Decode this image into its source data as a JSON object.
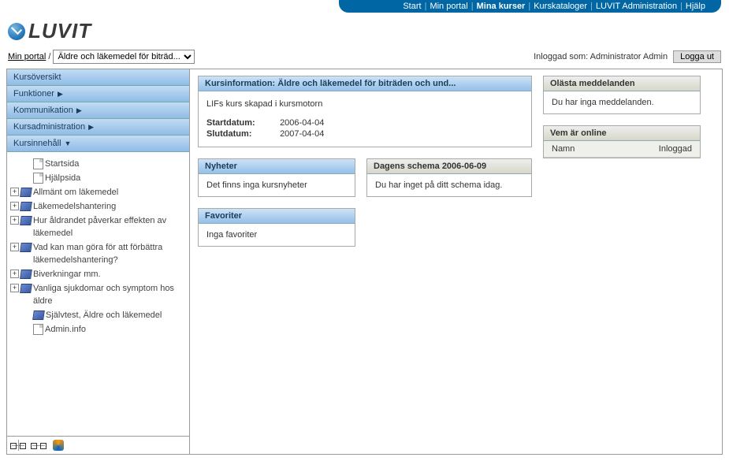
{
  "topnav": {
    "items": [
      {
        "label": "Start"
      },
      {
        "label": "Min portal"
      },
      {
        "label": "Mina kurser",
        "active": true
      },
      {
        "label": "Kurskataloger"
      },
      {
        "label": "LUVIT Administration"
      },
      {
        "label": "Hjälp"
      }
    ]
  },
  "logo": {
    "text": "LUVIT"
  },
  "breadcrumb": {
    "portal_link": "Min portal",
    "sep": " / ",
    "course_select_value": "Äldre och läkemedel för biträd..."
  },
  "login": {
    "prefix": "Inloggad som: ",
    "user": "Administrator Admin",
    "logout": "Logga ut"
  },
  "sidebar": {
    "sections": [
      {
        "label": "Kursöversikt",
        "expanded": false,
        "arrow": ""
      },
      {
        "label": "Funktioner",
        "expanded": false,
        "arrow": "▶"
      },
      {
        "label": "Kommunikation",
        "expanded": false,
        "arrow": "▶"
      },
      {
        "label": "Kursadministration",
        "expanded": false,
        "arrow": "▶"
      },
      {
        "label": "Kursinnehåll",
        "expanded": true,
        "arrow": "▼"
      }
    ],
    "tree": [
      {
        "indent": 1,
        "expander": "",
        "icon": "doc",
        "label": "Startsida"
      },
      {
        "indent": 1,
        "expander": "",
        "icon": "doc",
        "label": "Hjälpsida"
      },
      {
        "indent": 0,
        "expander": "+",
        "icon": "book",
        "label": "Allmänt om läkemedel"
      },
      {
        "indent": 0,
        "expander": "+",
        "icon": "book",
        "label": "Läkemedelshantering"
      },
      {
        "indent": 0,
        "expander": "+",
        "icon": "book",
        "label": "Hur åldrandet påverkar effekten av läkemedel"
      },
      {
        "indent": 0,
        "expander": "+",
        "icon": "book",
        "label": "Vad kan man göra för att förbättra läkemedelshantering?"
      },
      {
        "indent": 0,
        "expander": "+",
        "icon": "book",
        "label": "Biverkningar mm."
      },
      {
        "indent": 0,
        "expander": "+",
        "icon": "book",
        "label": "Vanliga sjukdomar och symptom hos äldre"
      },
      {
        "indent": 1,
        "expander": "",
        "icon": "book",
        "label": "Självtest, Äldre och läkemedel"
      },
      {
        "indent": 1,
        "expander": "",
        "icon": "doc",
        "label": "Admin.info"
      }
    ]
  },
  "panels": {
    "kursinfo": {
      "title": "Kursinformation: Äldre och läkemedel för biträden och und...",
      "desc": "LIFs kurs skapad i kursmotorn",
      "start_label": "Startdatum:",
      "start_value": "2006-04-04",
      "end_label": "Slutdatum:",
      "end_value": "2007-04-04"
    },
    "nyheter": {
      "title": "Nyheter",
      "body": "Det finns inga kursnyheter"
    },
    "schema": {
      "title": "Dagens schema 2006-06-09",
      "body": "Du har inget på ditt schema idag."
    },
    "favoriter": {
      "title": "Favoriter",
      "body": "Inga favoriter"
    },
    "olasta": {
      "title": "Olästa meddelanden",
      "body": "Du har inga meddelanden."
    },
    "online": {
      "title": "Vem är online",
      "col1": "Namn",
      "col2": "Inloggad"
    }
  }
}
